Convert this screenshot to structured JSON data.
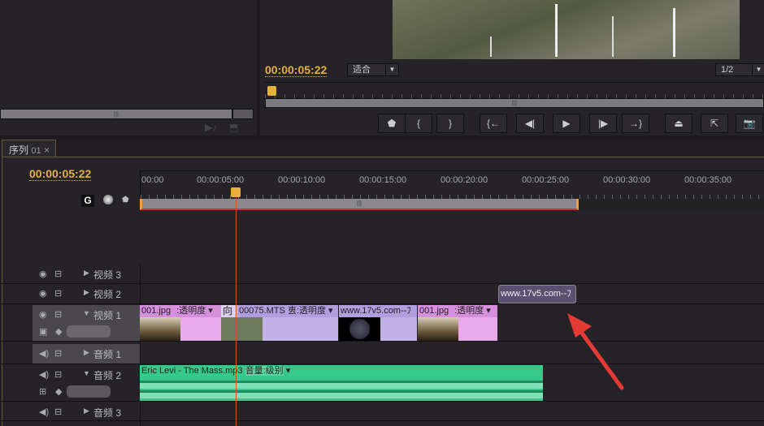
{
  "source_monitor": {
    "scroll_grip": "|||"
  },
  "program_monitor": {
    "timecode": "00:00:05:22",
    "fit_label": "适合",
    "quality_label": "1/2",
    "buttons": [
      {
        "icon": "marker-icon",
        "glyph": "⬟"
      },
      {
        "icon": "mark-in-icon",
        "glyph": "{"
      },
      {
        "icon": "mark-out-icon",
        "glyph": "}"
      },
      {
        "icon": "go-to-in-icon",
        "glyph": "{←"
      },
      {
        "icon": "step-back-icon",
        "glyph": "◀|"
      },
      {
        "icon": "play-icon",
        "glyph": "▶"
      },
      {
        "icon": "step-forward-icon",
        "glyph": "|▶"
      },
      {
        "icon": "go-to-out-icon",
        "glyph": "→}"
      },
      {
        "icon": "lift-icon",
        "glyph": "⏏"
      },
      {
        "icon": "extract-icon",
        "glyph": "⇱"
      },
      {
        "icon": "export-frame-icon",
        "glyph": "📷"
      }
    ]
  },
  "timeline": {
    "tab_label": "序列",
    "tab_number": "01",
    "tab_close": "×",
    "timecode": "00:00:05:22",
    "ruler_labels": [
      "00:00",
      "00:00:05:00",
      "00:00:10:00",
      "00:00:15:00",
      "00:00:20:00",
      "00:00:25:00",
      "00:00:30:00",
      "00:00:35:00"
    ],
    "playhead_seconds": 5.9,
    "work_area_end_seconds": 27,
    "tracks": {
      "video3": "视频 3",
      "video2": "视频 2",
      "video1": "视频 1",
      "audio1": "音频 1",
      "audio2": "音频 2",
      "audio3": "音频 3"
    },
    "clips": {
      "v1_a": {
        "name": "001.jpg",
        "effect": ":透明度"
      },
      "v1_trans": {
        "name": "向"
      },
      "v1_b": {
        "name": "00075.MTS",
        "effect": "叀:透明度"
      },
      "v1_c": {
        "name": "www.17v5.com--ﾌ"
      },
      "v1_d": {
        "name": "001.jpg",
        "effect": ":透明度"
      },
      "v2_a": {
        "name": "www.17v5.com--ﾌ"
      },
      "a2_a": {
        "name": "Eric Levi - The Mass.mp3",
        "effect": "音量:级别"
      }
    }
  },
  "colors": {
    "accent": "#e8b13c",
    "pink_clip": "#e9a9ea",
    "lavender_clip": "#c2b1e6",
    "audio_clip": "#35c98a",
    "arrow": "#e53935"
  }
}
